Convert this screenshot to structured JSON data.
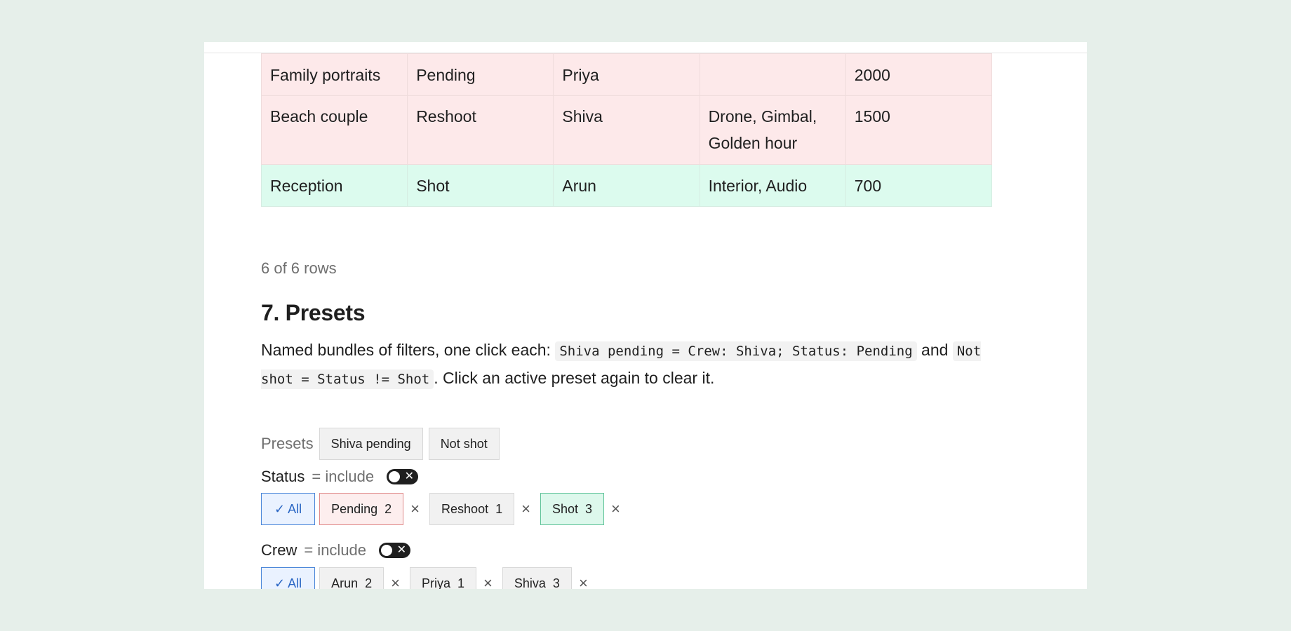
{
  "table": {
    "rows": [
      {
        "cells": [
          "Family portraits",
          "Pending",
          "Priya",
          "",
          "2000"
        ]
      },
      {
        "cells": [
          "Beach couple",
          "Reshoot",
          "Shiva",
          "Drone, Gimbal, Golden hour",
          "1500"
        ]
      },
      {
        "cells": [
          "Reception",
          "Shot",
          "Arun",
          "Interior, Audio",
          "700"
        ]
      }
    ]
  },
  "row_count": "6 of 6 rows",
  "section": {
    "title": "7. Presets",
    "desc_pre": "Named bundles of filters, one click each: ",
    "code1": "Shiva pending = Crew: Shiva; Status: Pending",
    "desc_and": " and ",
    "code2": "Not shot = Status != Shot",
    "desc_post": ". Click an active preset again to clear it."
  },
  "presets": {
    "label": "Presets",
    "buttons": [
      "Shiva pending",
      "Not shot"
    ]
  },
  "filters": {
    "status": {
      "name": "Status",
      "mode": "= include",
      "all_label": "✓ All",
      "chips": [
        {
          "label": "Pending",
          "count": "2"
        },
        {
          "label": "Reshoot",
          "count": "1"
        },
        {
          "label": "Shot",
          "count": "3"
        }
      ]
    },
    "crew": {
      "name": "Crew",
      "mode": "= include",
      "all_label": "✓ All",
      "chips": [
        {
          "label": "Arun",
          "count": "2"
        },
        {
          "label": "Priya",
          "count": "1"
        },
        {
          "label": "Shiva",
          "count": "3"
        }
      ]
    }
  },
  "icons": {
    "remove": "×",
    "toggle_x": "✕"
  },
  "colors": {
    "pending_row": "#fde9ea",
    "shot_row": "#dcfbee",
    "all_chip_accent": "#4a86d9"
  }
}
